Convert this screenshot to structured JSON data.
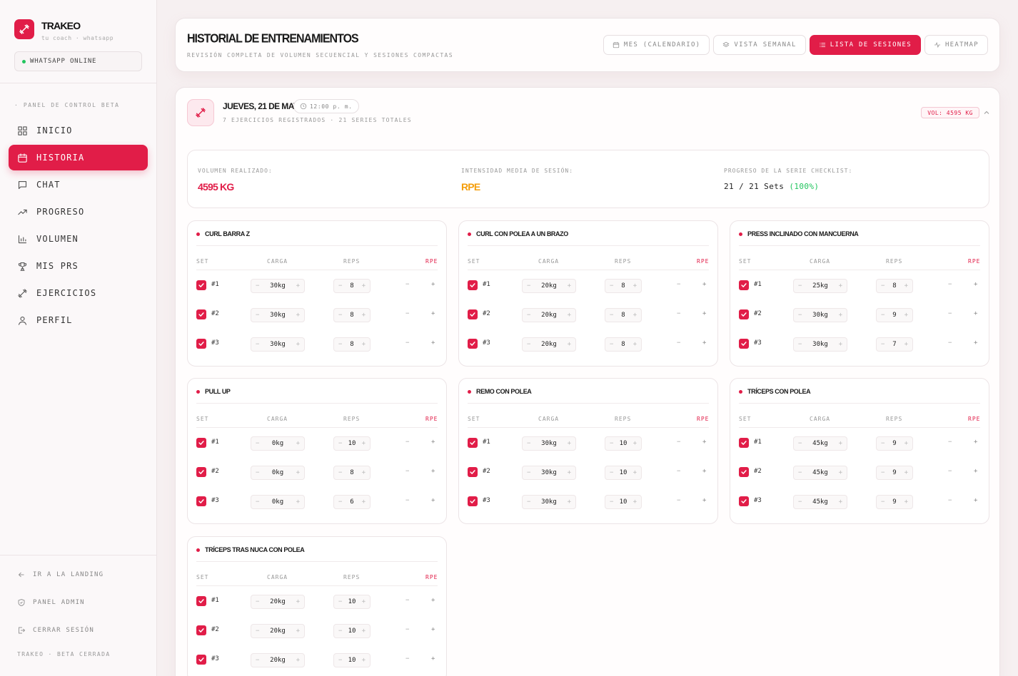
{
  "brand": {
    "name": "TRAKEO",
    "tagline": "tu coach · whatsapp",
    "status": "WHATSAPP ONLINE"
  },
  "sidebar": {
    "section": "· PANEL DE CONTROL BETA",
    "items": [
      {
        "label": "INICIO",
        "icon": "grid-icon"
      },
      {
        "label": "HISTORIA",
        "icon": "calendar-icon"
      },
      {
        "label": "CHAT",
        "icon": "chat-icon"
      },
      {
        "label": "PROGRESO",
        "icon": "trend-icon"
      },
      {
        "label": "VOLUMEN",
        "icon": "bar-chart-icon"
      },
      {
        "label": "MIS PRS",
        "icon": "trophy-icon"
      },
      {
        "label": "EJERCICIOS",
        "icon": "dumbbell-icon"
      },
      {
        "label": "PERFIL",
        "icon": "user-icon"
      }
    ],
    "active": "HISTORIA",
    "bottom": [
      {
        "label": "IR A LA LANDING",
        "icon": "arrow-left-icon"
      },
      {
        "label": "PANEL ADMIN",
        "icon": "shield-icon"
      },
      {
        "label": "CERRAR SESIÓN",
        "icon": "logout-icon"
      }
    ],
    "footer": "TRAKEO · BETA CERRADA"
  },
  "header": {
    "title": "HISTORIAL DE ENTRENAMIENTOS",
    "subtitle": "REVISIÓN COMPLETA DE VOLUMEN SECUENCIAL Y SESIONES COMPACTAS",
    "views": [
      {
        "label": "MES (CALENDARIO)",
        "icon": "calendar-icon"
      },
      {
        "label": "VISTA SEMANAL",
        "icon": "layers-icon"
      },
      {
        "label": "LISTA DE SESIONES",
        "icon": "list-icon"
      },
      {
        "label": "HEATMAP",
        "icon": "activity-icon"
      }
    ],
    "active_view": "LISTA DE SESIONES"
  },
  "session": {
    "date": "JUEVES, 21 DE MAYO",
    "time": "12:00 p. m.",
    "meta": "7 EJERCICIOS REGISTRADOS · 21 SERIES TOTALES",
    "volume_badge": "VOL: 4595 KG",
    "summary": {
      "volume_label": "VOLUMEN REALIZADO:",
      "volume_value": "4595 KG",
      "intensity_label": "INTENSIDAD MEDIA DE SESIÓN:",
      "intensity_value": "RPE",
      "progress_label": "PROGRESO DE LA SERIE CHECKLIST:",
      "progress_value": "21 / 21 Sets",
      "progress_pct": "(100%)"
    },
    "columns": {
      "set": "SET",
      "carga": "CARGA",
      "reps": "REPS",
      "rpe": "RPE"
    },
    "exercises": [
      {
        "name": "CURL BARRA Z",
        "sets": [
          {
            "num": "#1",
            "carga": "30kg",
            "reps": "8"
          },
          {
            "num": "#2",
            "carga": "30kg",
            "reps": "8"
          },
          {
            "num": "#3",
            "carga": "30kg",
            "reps": "8"
          }
        ]
      },
      {
        "name": "CURL CON POLEA A UN BRAZO",
        "sets": [
          {
            "num": "#1",
            "carga": "20kg",
            "reps": "8"
          },
          {
            "num": "#2",
            "carga": "20kg",
            "reps": "8"
          },
          {
            "num": "#3",
            "carga": "20kg",
            "reps": "8"
          }
        ]
      },
      {
        "name": "PRESS INCLINADO CON MANCUERNA",
        "sets": [
          {
            "num": "#1",
            "carga": "25kg",
            "reps": "8"
          },
          {
            "num": "#2",
            "carga": "30kg",
            "reps": "9"
          },
          {
            "num": "#3",
            "carga": "30kg",
            "reps": "7"
          }
        ]
      },
      {
        "name": "PULL UP",
        "sets": [
          {
            "num": "#1",
            "carga": "0kg",
            "reps": "10"
          },
          {
            "num": "#2",
            "carga": "0kg",
            "reps": "8"
          },
          {
            "num": "#3",
            "carga": "0kg",
            "reps": "6"
          }
        ]
      },
      {
        "name": "REMO CON POLEA",
        "sets": [
          {
            "num": "#1",
            "carga": "30kg",
            "reps": "10"
          },
          {
            "num": "#2",
            "carga": "30kg",
            "reps": "10"
          },
          {
            "num": "#3",
            "carga": "30kg",
            "reps": "10"
          }
        ]
      },
      {
        "name": "TRÍCEPS CON POLEA",
        "sets": [
          {
            "num": "#1",
            "carga": "45kg",
            "reps": "9"
          },
          {
            "num": "#2",
            "carga": "45kg",
            "reps": "9"
          },
          {
            "num": "#3",
            "carga": "45kg",
            "reps": "9"
          }
        ]
      },
      {
        "name": "TRÍCEPS TRAS NUCA CON POLEA",
        "sets": [
          {
            "num": "#1",
            "carga": "20kg",
            "reps": "10"
          },
          {
            "num": "#2",
            "carga": "20kg",
            "reps": "10"
          },
          {
            "num": "#3",
            "carga": "20kg",
            "reps": "10"
          }
        ]
      }
    ]
  },
  "colors": {
    "accent": "#e11d48",
    "amber": "#f59e0b",
    "green": "#22c55e"
  }
}
